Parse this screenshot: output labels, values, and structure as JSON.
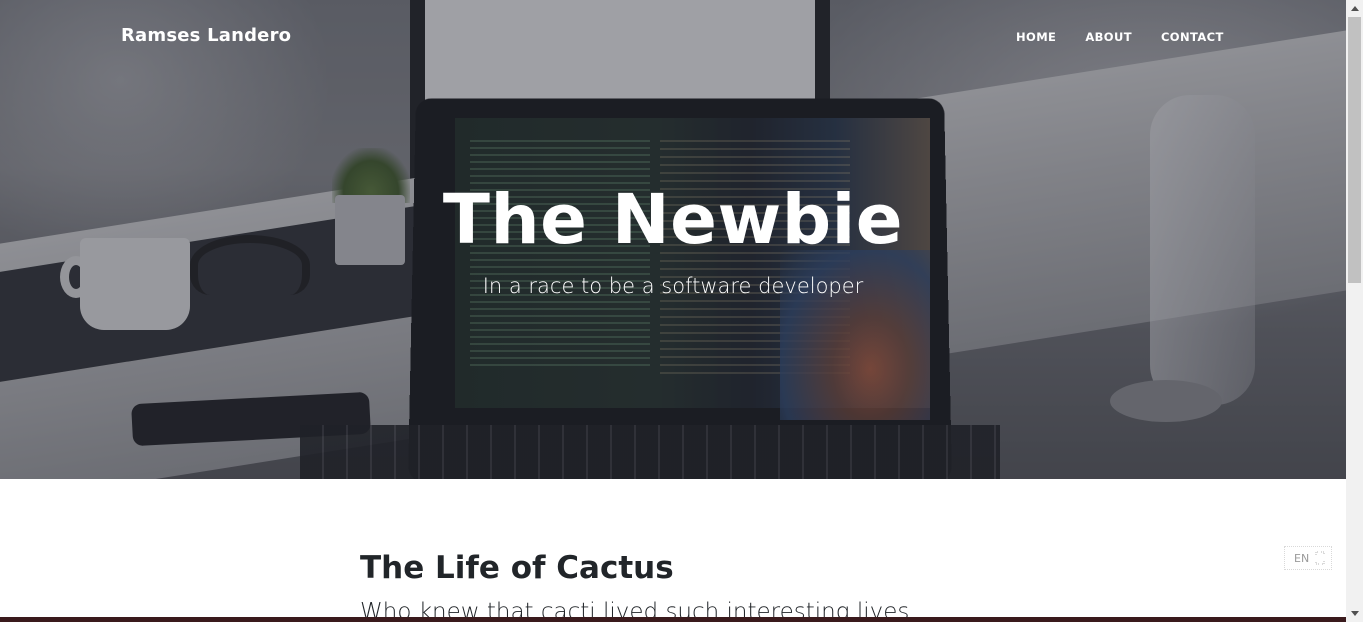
{
  "header": {
    "brand": "Ramses Landero",
    "nav": [
      {
        "label": "HOME"
      },
      {
        "label": "ABOUT"
      },
      {
        "label": "CONTACT"
      }
    ]
  },
  "hero": {
    "title": "The Newbie",
    "subtitle": "In a race to be a software developer"
  },
  "post": {
    "title": "The Life of Cactus",
    "subtitle": "Who knew that cacti lived such interesting lives."
  },
  "language_widget": {
    "code": "EN",
    "icon": "expand-icon"
  },
  "colors": {
    "text_dark": "#212529",
    "hero_overlay": "#282a34",
    "scrollbar_track": "#f1f1f1",
    "scrollbar_thumb": "#c1c1c1"
  }
}
